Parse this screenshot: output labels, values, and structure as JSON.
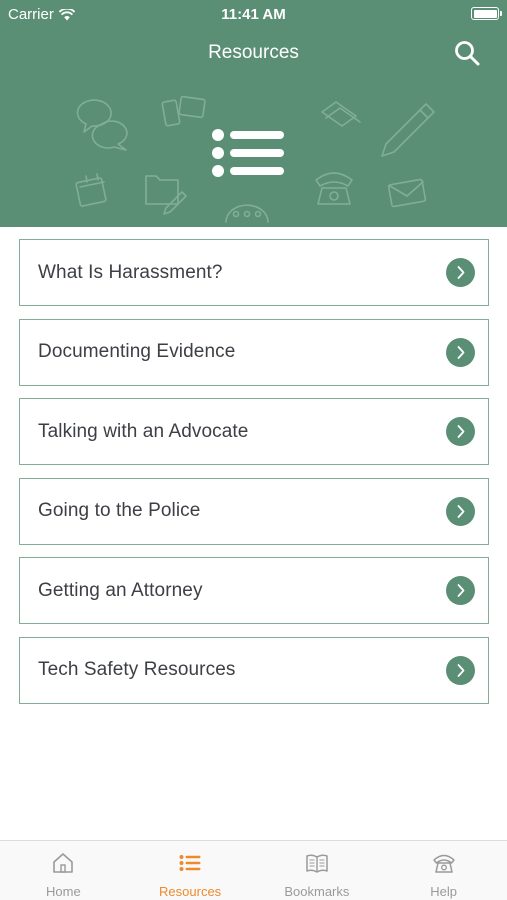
{
  "status_bar": {
    "carrier": "Carrier",
    "time": "11:41 AM",
    "battery_level": 1.0
  },
  "header": {
    "title": "Resources",
    "search_icon": "search-icon",
    "hero_icon": "list-icon",
    "background_color": "#5a8f75"
  },
  "resources": {
    "items": [
      {
        "label": "What Is Harassment?"
      },
      {
        "label": "Documenting Evidence"
      },
      {
        "label": "Talking with an Advocate"
      },
      {
        "label": "Going to the Police"
      },
      {
        "label": "Getting an Attorney"
      },
      {
        "label": "Tech Safety Resources"
      }
    ],
    "chevron_icon": "chevron-right-icon",
    "accent_color": "#5a8f75"
  },
  "tabbar": {
    "tabs": [
      {
        "label": "Home",
        "icon": "home-icon"
      },
      {
        "label": "Resources",
        "icon": "list-icon",
        "active": true
      },
      {
        "label": "Bookmarks",
        "icon": "book-icon"
      },
      {
        "label": "Help",
        "icon": "phone-icon"
      }
    ],
    "active_color": "#ef8a2c",
    "inactive_color": "#9a9a9a"
  }
}
